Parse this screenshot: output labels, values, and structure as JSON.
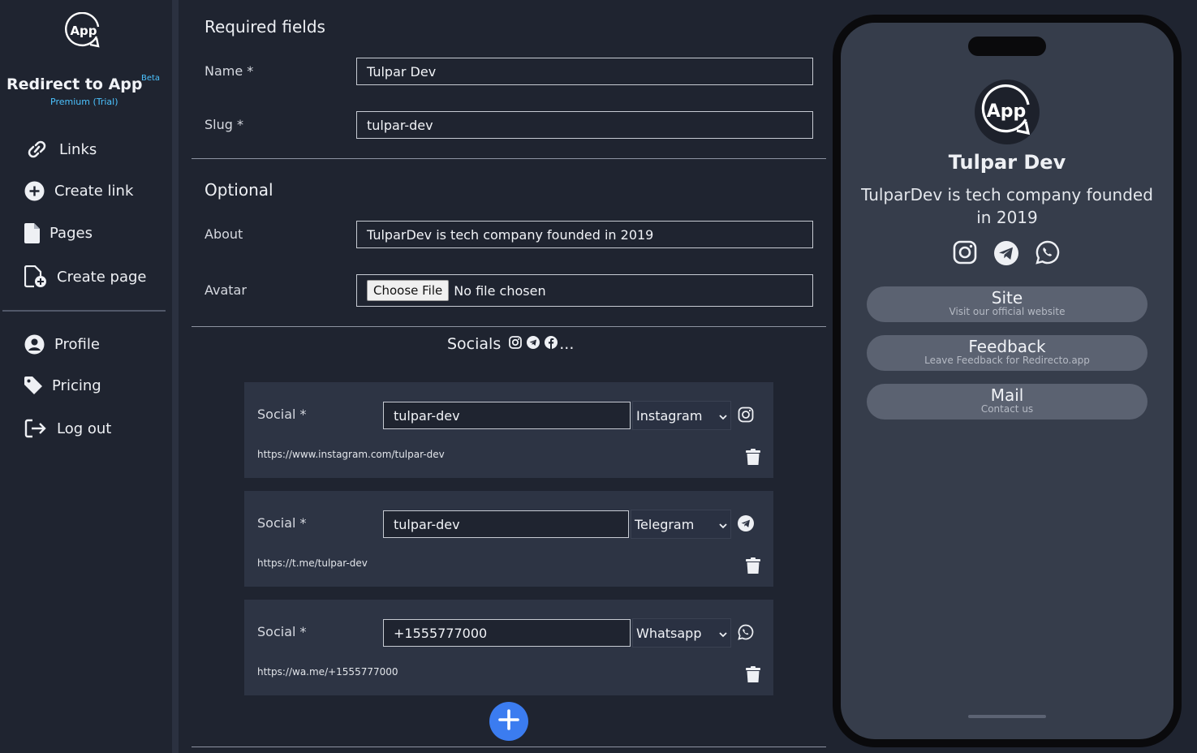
{
  "sidebar": {
    "logo_text": "App",
    "brand": "Redirect to App",
    "beta": "Beta",
    "plan": "Premium (Trial)",
    "items": [
      {
        "label": "Links",
        "icon": "link-icon"
      },
      {
        "label": "Create link",
        "icon": "plus-circle-icon"
      },
      {
        "label": "Pages",
        "icon": "file-icon"
      },
      {
        "label": "Create page",
        "icon": "file-plus-icon"
      },
      {
        "label": "Profile",
        "icon": "user-circle-icon"
      },
      {
        "label": "Pricing",
        "icon": "tag-icon"
      },
      {
        "label": "Log out",
        "icon": "logout-icon"
      }
    ]
  },
  "form": {
    "required_title": "Required fields",
    "name_label": "Name *",
    "name_value": "Tulpar Dev",
    "slug_label": "Slug *",
    "slug_value": "tulpar-dev",
    "optional_title": "Optional",
    "about_label": "About",
    "about_value": "TulparDev is tech company founded in 2019",
    "avatar_label": "Avatar",
    "file_button": "Choose File",
    "file_status": "No file chosen",
    "socials_title": "Socials",
    "socials_suffix": "...",
    "socials": [
      {
        "label": "Social *",
        "value": "tulpar-dev",
        "platform": "Instagram",
        "url": "https://www.instagram.com/tulpar-dev",
        "icon": "instagram-icon"
      },
      {
        "label": "Social *",
        "value": "tulpar-dev",
        "platform": "Telegram",
        "url": "https://t.me/tulpar-dev",
        "icon": "telegram-icon"
      },
      {
        "label": "Social *",
        "value": "+1555777000",
        "platform": "Whatsapp",
        "url": "https://wa.me/+1555777000",
        "icon": "whatsapp-icon"
      }
    ]
  },
  "preview": {
    "avatar_text": "App",
    "name": "Tulpar Dev",
    "about": "TulparDev is tech company founded in 2019",
    "links": [
      {
        "title": "Site",
        "subtitle": "Visit our official website"
      },
      {
        "title": "Feedback",
        "subtitle": "Leave Feedback for Redirecto.app"
      },
      {
        "title": "Mail",
        "subtitle": "Contact us"
      }
    ]
  },
  "colors": {
    "background": "#1f2430",
    "accent": "#4cc3ff",
    "add_button": "#3b7cf0",
    "phone_screen": "#363d4b"
  }
}
